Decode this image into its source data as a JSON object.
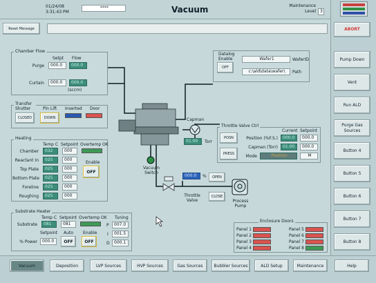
{
  "header": {
    "date": "01/24/08",
    "time": "3:31:43 PM",
    "password_mask": "****",
    "title": "Vacuum",
    "maintenance_label": "Maintenance",
    "level_label": "Level",
    "level_value": "3",
    "reset_label": "Reset Message",
    "message_text": ""
  },
  "sidebar": {
    "abort": "ABORT",
    "buttons": [
      "Pump Down",
      "Vent",
      "Run ALD",
      "Purge Gas Sources",
      "Button 4",
      "Button 5",
      "Button 6",
      "Button 7",
      "Button 8"
    ]
  },
  "chamber_flow": {
    "title": "Chamber Flow",
    "setpt_header": "Setpt",
    "flow_header": "Flow",
    "purge_label": "Purge",
    "purge_setpt": "000.0",
    "purge_flow": "000.0",
    "curtain_label": "Curtain",
    "curtain_setpt": "000.0",
    "curtain_flow": "000.0",
    "unit": "(sccm)"
  },
  "transfer": {
    "title": "Transfer Shutter",
    "pin_lift": "Pin Lift",
    "inserted": "Inserted",
    "door": "Door",
    "closed_btn": "CLOSED",
    "down_btn": "DOWN",
    "inserted_color": "#2a58b0",
    "door_color": "#d9534f"
  },
  "heating": {
    "title": "Heating",
    "temp_header": "Temp C",
    "setpoint_header": "Setpoint",
    "overtemp_label": "Overtemp OK",
    "enable_label": "Enable",
    "enable_btn": "OFF",
    "rows": [
      {
        "label": "Chamber",
        "temp": "032",
        "setpoint": "000"
      },
      {
        "label": "Reactant In",
        "temp": "025",
        "setpoint": "000"
      },
      {
        "label": "Top Plate",
        "temp": "025",
        "setpoint": "000"
      },
      {
        "label": "Bottom Plate",
        "temp": "025",
        "setpoint": "000"
      },
      {
        "label": "Foreline",
        "temp": "025",
        "setpoint": "000"
      },
      {
        "label": "Roughing",
        "temp": "025",
        "setpoint": "000"
      }
    ]
  },
  "substrate": {
    "title": "Substrate Heater",
    "temp_header": "Temp C",
    "setpoint_header": "Setpoint",
    "overtemp_label": "Overtemp OK",
    "tuning_header": "Tuning",
    "substrate_label": "Substrate",
    "temp": "081",
    "setpoint": "081",
    "p_label": "P",
    "p_value": "007.0",
    "i_label": "I",
    "i_value": "001.5",
    "d_label": "D",
    "d_value": "000.1",
    "sub_setpoint_label": "Setpoint",
    "auto_label": "Auto",
    "enable_label": "Enable",
    "power_label": "% Power",
    "power_value": "000.0",
    "auto_btn": "OFF",
    "enable_btn": "OFF"
  },
  "datalog": {
    "title": "Datalog Enable",
    "off_btn": "OFF",
    "wafer_value": "Wafer1",
    "wafer_label": "WaferID",
    "path_value": "c:\\ald\\data\\wafer\\",
    "path_label": "Path"
  },
  "capman": {
    "label": "Capman",
    "value": "01.00",
    "unit": "Torr"
  },
  "throttle": {
    "title": "Throttle Valve Ctrl",
    "current_header": "Current",
    "setpoint_header": "Setpoint",
    "posn_btn": "POSN",
    "press_btn": "PRESS",
    "position_label": "Position (%F.S.)",
    "position_current": "000.0",
    "position_setpoint": "000.0",
    "capman_label": "Capman (Torr)",
    "capman_current": "01.00",
    "capman_setpoint": "000.0",
    "mode_label": "Mode",
    "mode_value": "Position",
    "mode_setpoint": "M"
  },
  "diagram": {
    "vacuum_switch": "Vacuum Switch",
    "throttle_valve": "Throttle Valve",
    "throttle_pct": "000.0",
    "pct_unit": "%",
    "open_btn": "OPEN",
    "close_btn": "CLOSE",
    "process_pump": "Process Pump"
  },
  "enclosure": {
    "title": "Enclosure Doors",
    "left": [
      "Panel 1",
      "Panel 2",
      "Panel 3",
      "Panel 4"
    ],
    "right": [
      "Panel 5",
      "Panel 6",
      "Panel 7",
      "Panel 8"
    ],
    "closed_color": "#d9534f",
    "ok_color": "#3e9a56"
  },
  "tabs": [
    "Vacuum",
    "Deposition",
    "LVP Sources",
    "HVP Sources",
    "Gas Sources",
    "Bubbler Sources",
    "ALD Setup",
    "Maintenance",
    "Help"
  ]
}
